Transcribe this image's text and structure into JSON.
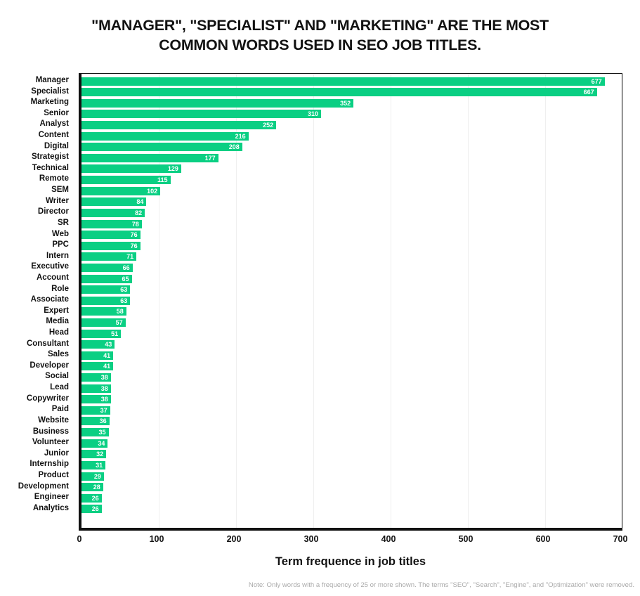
{
  "title": {
    "line1": "\"MANAGER\", \"SPECIALIST\" AND \"MARKETING\" ARE THE MOST",
    "line2": "COMMON WORDS USED IN SEO JOB TITLES."
  },
  "footnote": "Note: Only words with a frequency of 25 or more shown. The terms \"SEO\", \"Search\", \"Engine\", and \"Optimization\" were removed.",
  "colors": {
    "bar": "#0ACF83",
    "axis": "#121212",
    "grid": "#efefef",
    "value_label": "#ffffff",
    "footnote": "#aaaaaa",
    "background": "#ffffff"
  },
  "chart_data": {
    "type": "bar",
    "orientation": "horizontal",
    "title": "\"MANAGER\", \"SPECIALIST\" AND \"MARKETING\" ARE THE MOST COMMON WORDS USED IN SEO JOB TITLES.",
    "xlabel": "Term frequence in job titles",
    "ylabel": "",
    "xlim": [
      0,
      700
    ],
    "xticks": [
      0,
      100,
      200,
      300,
      400,
      500,
      600,
      700
    ],
    "grid": true,
    "grid_axis": "x",
    "legend": false,
    "value_labels": true,
    "categories": [
      "Manager",
      "Specialist",
      "Marketing",
      "Senior",
      "Analyst",
      "Content",
      "Digital",
      "Strategist",
      "Technical",
      "Remote",
      "SEM",
      "Writer",
      "Director",
      "SR",
      "Web",
      "PPC",
      "Intern",
      "Executive",
      "Account",
      "Role",
      "Associate",
      "Expert",
      "Media",
      "Head",
      "Consultant",
      "Sales",
      "Developer",
      "Social",
      "Lead",
      "Copywriter",
      "Paid",
      "Website",
      "Business",
      "Volunteer",
      "Junior",
      "Internship",
      "Product",
      "Development",
      "Engineer",
      "Analytics"
    ],
    "values": [
      677,
      667,
      352,
      310,
      252,
      216,
      208,
      177,
      129,
      115,
      102,
      84,
      82,
      78,
      76,
      76,
      71,
      66,
      65,
      63,
      63,
      58,
      57,
      51,
      43,
      41,
      41,
      38,
      38,
      38,
      37,
      36,
      35,
      34,
      32,
      31,
      29,
      28,
      26,
      26
    ]
  }
}
